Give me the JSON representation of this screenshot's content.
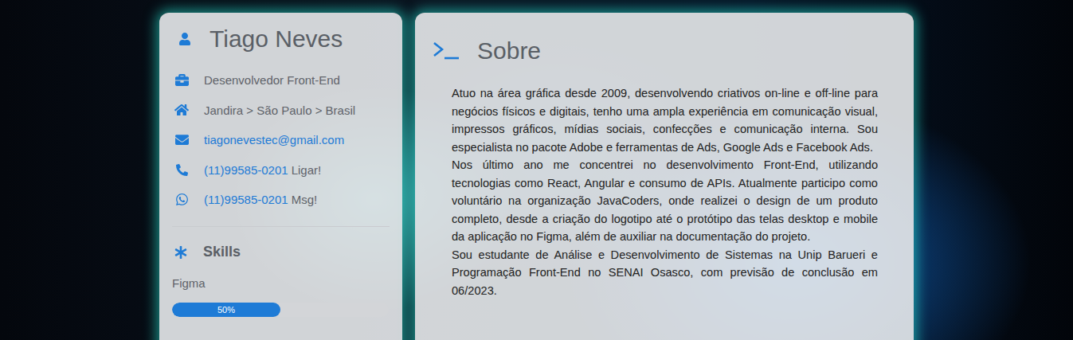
{
  "profile": {
    "name": "Tiago Neves",
    "info": [
      {
        "kind": "role",
        "text": "Desenvolvedor Front-End",
        "linked": false
      },
      {
        "kind": "location",
        "text": "Jandira > São Paulo > Brasil",
        "linked": false
      },
      {
        "kind": "email",
        "text": "tiagonevestec@gmail.com",
        "linked": true
      },
      {
        "kind": "phone",
        "text": "(11)99585-0201",
        "linked": true,
        "suffix": "Ligar!"
      },
      {
        "kind": "whatsapp",
        "text": "(11)99585-0201",
        "linked": true,
        "suffix": "Msg!"
      }
    ]
  },
  "skills": {
    "title": "Skills",
    "items": [
      {
        "name": "Figma",
        "level": 0.5,
        "reading": "50%"
      }
    ]
  },
  "about": {
    "title": "Sobre",
    "paragraphs": [
      "Atuo na área gráfica desde 2009, desenvolvendo criativos on-line e off-line para negócios físicos e digitais, tenho uma ampla experiência em comunicação visual, impressos gráficos, mídias sociais, confecções e comunicação interna. Sou especialista no pacote Adobe e ferramentas de Ads, Google Ads e Facebook Ads.",
      "Nos último ano me concentrei no desenvolvimento Front-End, utilizando tecnologias como React, Angular e consumo de APIs. Atualmente participo como voluntário na organização JavaCoders, onde realizei o design de um produto completo, desde a criação do logotipo até o protótipo das telas desktop e mobile da aplicação no Figma, além de auxiliar na documentação do projeto.",
      "Sou estudante de Análise e Desenvolvimento de Sistemas na Unip Barueri e Programação Front-End no SENAI Osasco, com previsão de conclusão em 06/2023."
    ]
  }
}
